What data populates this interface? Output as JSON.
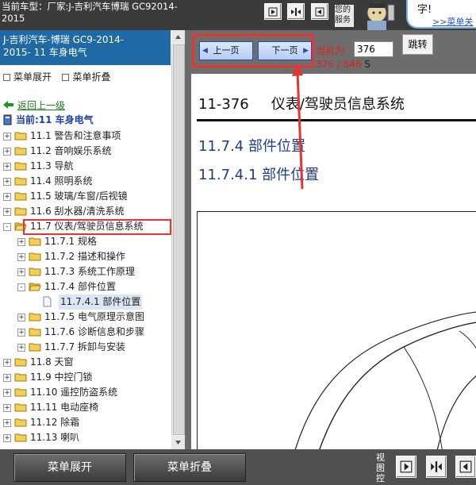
{
  "topbar": {
    "car_title": "当前车型：厂家:J-吉利汽车博瑞  GC92014-\n2015",
    "greeting": "您的服务",
    "bubble_char": "字!",
    "bubble_link": ">>菜单关"
  },
  "left": {
    "header": "J-吉利汽车-博瑞 GC9-2014-\n2015- 11 车身电气",
    "expand_label": "菜单展开",
    "collapse_label": "菜单折叠",
    "back_link": "返回上一级",
    "current": "当前:11 车身电气",
    "tree": [
      {
        "level": 0,
        "pm": "+",
        "icon": "folder",
        "label": "11.1 警告和注意事项"
      },
      {
        "level": 0,
        "pm": "+",
        "icon": "folder",
        "label": "11.2 音响娱乐系统"
      },
      {
        "level": 0,
        "pm": "+",
        "icon": "folder",
        "label": "11.3 导航"
      },
      {
        "level": 0,
        "pm": "+",
        "icon": "folder",
        "label": "11.4 照明系统"
      },
      {
        "level": 0,
        "pm": "+",
        "icon": "folder",
        "label": "11.5 玻璃/车窗/后视镜"
      },
      {
        "level": 0,
        "pm": "+",
        "icon": "folder",
        "label": "11.6 刮水器/清洗系统"
      },
      {
        "level": 0,
        "pm": "-",
        "icon": "folder-open",
        "label": "11.7 仪表/驾驶员信息系统"
      },
      {
        "level": 1,
        "pm": "+",
        "icon": "folder",
        "label": "11.7.1 规格"
      },
      {
        "level": 1,
        "pm": "+",
        "icon": "folder",
        "label": "11.7.2 描述和操作"
      },
      {
        "level": 1,
        "pm": "+",
        "icon": "folder",
        "label": "11.7.3 系统工作原理"
      },
      {
        "level": 1,
        "pm": "-",
        "icon": "folder-open",
        "label": "11.7.4 部件位置"
      },
      {
        "level": 2,
        "pm": "",
        "icon": "doc",
        "label": "11.7.4.1 部件位置"
      },
      {
        "level": 1,
        "pm": "+",
        "icon": "folder",
        "label": "11.7.5 电气原理示意图"
      },
      {
        "level": 1,
        "pm": "+",
        "icon": "folder",
        "label": "11.7.6 诊断信息和步骤"
      },
      {
        "level": 1,
        "pm": "+",
        "icon": "folder",
        "label": "11.7.7 拆卸与安装"
      },
      {
        "level": 0,
        "pm": "+",
        "icon": "folder",
        "label": "11.8 天窗"
      },
      {
        "level": 0,
        "pm": "+",
        "icon": "folder",
        "label": "11.9 中控门锁"
      },
      {
        "level": 0,
        "pm": "+",
        "icon": "folder",
        "label": "11.10 遥控防盗系统"
      },
      {
        "level": 0,
        "pm": "+",
        "icon": "folder",
        "label": "11.11 电动座椅"
      },
      {
        "level": 0,
        "pm": "+",
        "icon": "folder",
        "label": "11.12 除霜"
      },
      {
        "level": 0,
        "pm": "+",
        "icon": "folder",
        "label": "11.13 喇叭"
      }
    ]
  },
  "right": {
    "prev_label": "上一页",
    "next_label": "下一页",
    "current_label": "当前为",
    "page_input": "376",
    "jump_label": "跳转",
    "page_count": "376 / 846",
    "page_suffix": "S",
    "doc_code": "11-376",
    "doc_title": "仪表/驾驶员信息系统",
    "h1": "11.7.4 部件位置",
    "h2": "11.7.4.1 部件位置"
  },
  "bottom": {
    "expand_label": "菜单展开",
    "collapse_label": "菜单折叠",
    "view_label": "视图控"
  },
  "colors": {
    "accent_blue": "#1f6aa5",
    "highlight_red": "#e83333",
    "heading_blue": "#1f3c8c"
  }
}
